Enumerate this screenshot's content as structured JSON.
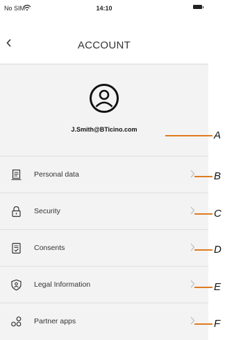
{
  "status_bar": {
    "carrier": "No SIM",
    "time": "14:10"
  },
  "nav": {
    "back_icon": "chevron-left-icon",
    "title": "ACCOUNT"
  },
  "profile": {
    "avatar_icon": "user-circle-icon",
    "email": "J.Smith@BTicino.com"
  },
  "menu": [
    {
      "label": "Personal data",
      "icon": "document-icon"
    },
    {
      "label": "Security",
      "icon": "lock-icon"
    },
    {
      "label": "Consents",
      "icon": "checklist-icon"
    },
    {
      "label": "Legal Information",
      "icon": "shield-icon"
    },
    {
      "label": "Partner apps",
      "icon": "apps-icon"
    }
  ],
  "callouts": [
    "A",
    "B",
    "C",
    "D",
    "E",
    "F"
  ],
  "colors": {
    "accent": "#e07a1f",
    "background": "#f3f3f3"
  }
}
